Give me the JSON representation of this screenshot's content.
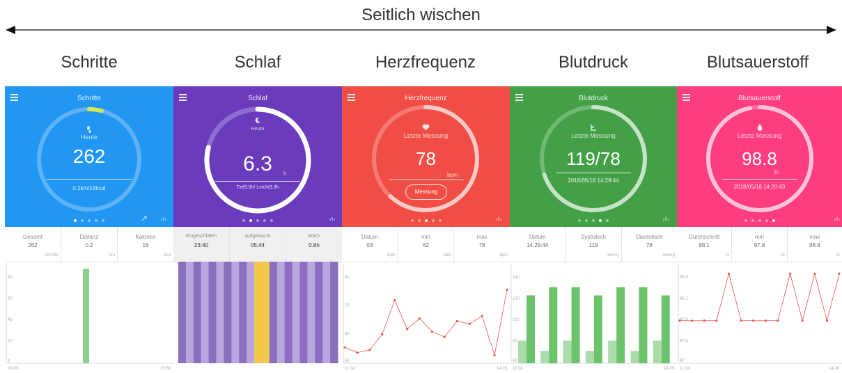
{
  "header": {
    "swipe_label": "Seitlich wischen"
  },
  "columns": [
    "Schritte",
    "Schlaf",
    "Herzfrequenz",
    "Blutdruck",
    "Blutsauerstoff"
  ],
  "panels": {
    "steps": {
      "color": "#2196f3",
      "title": "Schritte",
      "sub": "Heute",
      "value": "262",
      "foot": "0.2km/16kcal",
      "progress": 0.04,
      "stats": [
        {
          "label": "Gesamt",
          "value": "262",
          "unit": "Schritte"
        },
        {
          "label": "Distanz",
          "value": "0.2",
          "unit": "km"
        },
        {
          "label": "Kalorien",
          "value": "16",
          "unit": "kcal"
        }
      ],
      "chart_data": {
        "type": "bar",
        "yticks": [
          "80",
          "60",
          "40",
          "20",
          "0"
        ],
        "values": [
          0,
          0,
          0,
          0,
          0,
          0,
          0,
          0,
          0,
          0,
          0,
          0,
          1
        ],
        "start": "00:00",
        "end": "23:59"
      }
    },
    "sleep": {
      "color": "#6a3bbd",
      "title": "Schlaf",
      "sub": "Heute",
      "value": "6.3",
      "unit": "h",
      "foot": "Tief3.0h/ Leicht3.3h",
      "progress": 0.79,
      "stats": [
        {
          "label": "Eingeschlafen",
          "value": "23:40"
        },
        {
          "label": "Aufgewacht",
          "value": "05:44"
        },
        {
          "label": "Wach",
          "value": "0.8h"
        }
      ],
      "chart_data": {
        "type": "bar",
        "segments": [
          "deep",
          "light",
          "deep",
          "light",
          "deep",
          "light",
          "deep",
          "light",
          "deep",
          "light",
          "awake",
          "awake",
          "deep",
          "light",
          "deep",
          "light",
          "deep",
          "light",
          "deep",
          "light",
          "deep"
        ]
      }
    },
    "heart": {
      "color": "#f04e44",
      "title": "Herzfrequenz",
      "sub": "Letzte Messung",
      "value": "78",
      "unit": "bpm",
      "button": "Messung",
      "progress": 0.62,
      "stats": [
        {
          "label": "Datum",
          "value": "03",
          "unit": "bpm"
        },
        {
          "label": "min",
          "value": "62",
          "unit": "bpm"
        },
        {
          "label": "max",
          "value": "78",
          "unit": "bpm"
        }
      ],
      "chart_data": {
        "type": "line",
        "yticks": [
          "80",
          "70",
          "60",
          "50"
        ],
        "ymin": 50,
        "ymax": 84,
        "values": [
          55,
          53,
          54,
          60,
          73,
          62,
          66,
          61,
          59,
          65,
          64,
          67,
          52,
          77
        ],
        "start": "11:04",
        "end": "14:29"
      }
    },
    "bp": {
      "color": "#43a047",
      "title": "Blutdruck",
      "sub": "Letzte Messung",
      "value": "119/78",
      "foot": "2018/05/18 14:29:44",
      "progress": 0.7,
      "stats": [
        {
          "label": "Datum",
          "value": "14:29:44",
          "unit": ""
        },
        {
          "label": "Systolisch",
          "value": "119",
          "unit": "mmHg"
        },
        {
          "label": "Diastolisch",
          "value": "78",
          "unit": "mmHg"
        }
      ],
      "chart_data": {
        "type": "bar",
        "yticks": [
          "140",
          "120",
          "100",
          "80",
          "60"
        ],
        "ymin": 60,
        "ymax": 152,
        "pairs": [
          [
            82,
            126
          ],
          [
            72,
            134
          ],
          [
            82,
            134
          ],
          [
            72,
            126
          ],
          [
            82,
            134
          ],
          [
            72,
            134
          ],
          [
            82,
            126
          ]
        ],
        "start": "12:02",
        "end": "14:29"
      }
    },
    "spo2": {
      "color": "#ff3d7f",
      "title": "Blutsauerstoff",
      "sub": "Letzte Messung",
      "value": "98.8",
      "unit": "%",
      "foot": "2018/05/18 14:29:43",
      "progress": 0.97,
      "stats": [
        {
          "label": "Durchschnitt",
          "value": "98.1",
          "unit": "%"
        },
        {
          "label": "min",
          "value": "97.8",
          "unit": "%"
        },
        {
          "label": "max",
          "value": "98.8",
          "unit": "%"
        }
      ],
      "chart_data": {
        "type": "line",
        "yticks": [
          "98.6",
          "98.2",
          "97.8",
          "97.4",
          "97"
        ],
        "ymin": 96.95,
        "ymax": 98.85,
        "values": [
          97.8,
          97.8,
          97.8,
          97.8,
          98.8,
          97.8,
          97.8,
          97.8,
          97.8,
          98.8,
          97.8,
          98.8,
          97.8,
          98.8
        ],
        "start": "11:04",
        "end": "14:29"
      }
    }
  }
}
